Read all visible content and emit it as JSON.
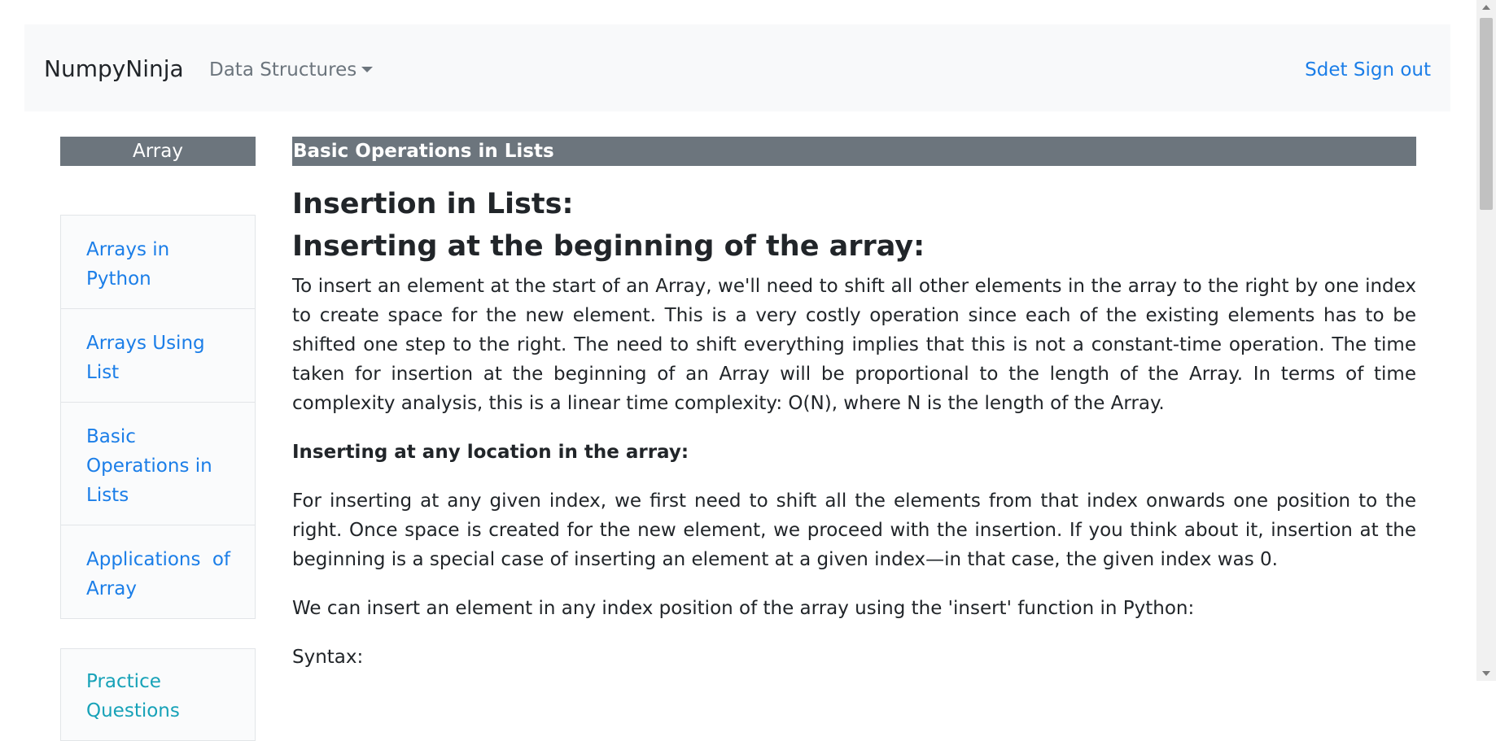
{
  "navbar": {
    "brand": "NumpyNinja",
    "dropdown_label": "Data Structures",
    "signout_label": "Sdet Sign out"
  },
  "sidebar": {
    "header": "Array",
    "items": [
      {
        "label": "Arrays in Python"
      },
      {
        "label": "Arrays Using List"
      },
      {
        "label": "Basic Operations in Lists"
      },
      {
        "label": "Applications of Array"
      }
    ],
    "practice_label": "Practice Questions"
  },
  "main": {
    "topic_title": "Basic Operations in Lists",
    "heading1": "Insertion in Lists:",
    "heading2": "Inserting at the beginning of the array:",
    "paragraph1": " To insert an element at the start of an Array, we'll need to shift all other elements in the array to the right by one index to create space for the new element. This is a very costly operation since each of the existing elements has to be shifted one step to the right. The need to shift everything implies that this is not a constant-time operation. The time taken for insertion at the beginning of an Array will be proportional to the length of the Array. In terms of time complexity analysis, this is a linear time complexity: O(N), where N is the length of the Array.",
    "subheading": "Inserting at any location in the array:",
    "paragraph2": "For inserting at any given index, we first need to shift all the elements from that index onwards one position to the right. Once space is created for the new element, we proceed with the insertion. If you think about it, insertion at the beginning is a special case of inserting an element at a given index—in that case, the given index was 0.",
    "paragraph3": "We can insert an element in any index position of the array using the 'insert' function in Python:",
    "paragraph4": "Syntax:"
  },
  "colors": {
    "link": "#1b7ee8",
    "practice_link": "#17a2b8",
    "header_bg": "#6c757d",
    "navbar_bg": "#f8f9fa"
  }
}
